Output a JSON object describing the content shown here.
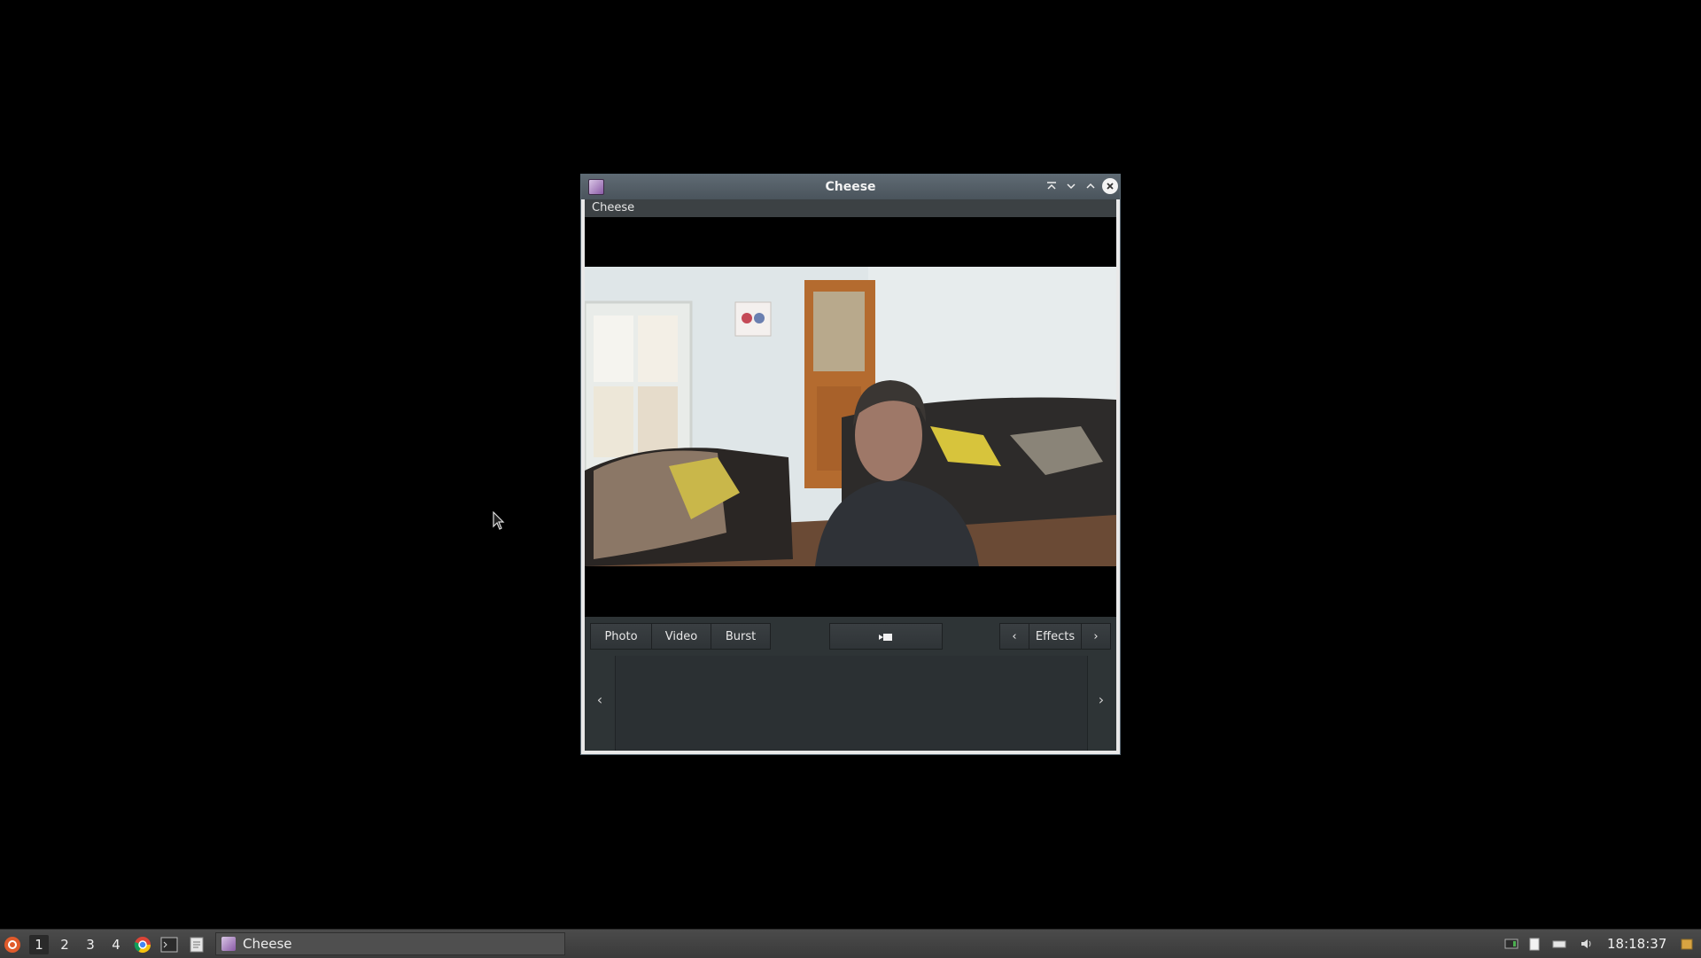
{
  "window": {
    "title": "Cheese",
    "menu_label": "Cheese"
  },
  "toolbar": {
    "mode_buttons": [
      "Photo",
      "Video",
      "Burst"
    ],
    "effects_label": "Effects",
    "effects_prev": "‹",
    "effects_next": "›"
  },
  "thumbnails": {
    "prev": "‹",
    "next": "›"
  },
  "taskbar": {
    "workspaces": [
      "1",
      "2",
      "3",
      "4"
    ],
    "active_workspace": "1",
    "task_title": "Cheese",
    "clock": "18:18:37"
  },
  "icons": {
    "window_controls": [
      "shade-icon",
      "minimize-icon",
      "maximize-icon",
      "close-icon"
    ],
    "launchers": [
      "chrome-icon",
      "terminal-icon",
      "files-icon"
    ],
    "tray": [
      "network-icon",
      "clipboard-icon",
      "keyboard-icon",
      "volume-icon",
      "notes-icon"
    ]
  },
  "colors": {
    "window_frame": "#4a545c",
    "app_background": "#2e3436",
    "taskbar": "#3f3f3f"
  }
}
